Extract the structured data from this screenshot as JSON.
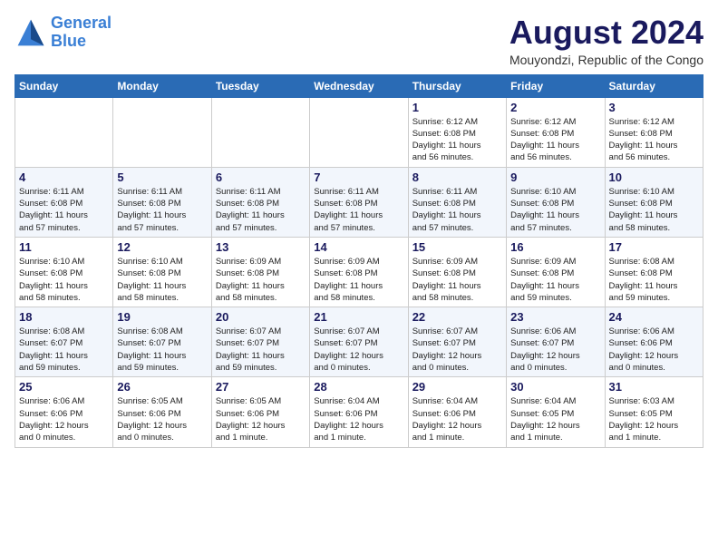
{
  "header": {
    "logo_line1": "General",
    "logo_line2": "Blue",
    "month_year": "August 2024",
    "location": "Mouyondzi, Republic of the Congo"
  },
  "weekdays": [
    "Sunday",
    "Monday",
    "Tuesday",
    "Wednesday",
    "Thursday",
    "Friday",
    "Saturday"
  ],
  "weeks": [
    [
      {
        "day": "",
        "info": ""
      },
      {
        "day": "",
        "info": ""
      },
      {
        "day": "",
        "info": ""
      },
      {
        "day": "",
        "info": ""
      },
      {
        "day": "1",
        "info": "Sunrise: 6:12 AM\nSunset: 6:08 PM\nDaylight: 11 hours\nand 56 minutes."
      },
      {
        "day": "2",
        "info": "Sunrise: 6:12 AM\nSunset: 6:08 PM\nDaylight: 11 hours\nand 56 minutes."
      },
      {
        "day": "3",
        "info": "Sunrise: 6:12 AM\nSunset: 6:08 PM\nDaylight: 11 hours\nand 56 minutes."
      }
    ],
    [
      {
        "day": "4",
        "info": "Sunrise: 6:11 AM\nSunset: 6:08 PM\nDaylight: 11 hours\nand 57 minutes."
      },
      {
        "day": "5",
        "info": "Sunrise: 6:11 AM\nSunset: 6:08 PM\nDaylight: 11 hours\nand 57 minutes."
      },
      {
        "day": "6",
        "info": "Sunrise: 6:11 AM\nSunset: 6:08 PM\nDaylight: 11 hours\nand 57 minutes."
      },
      {
        "day": "7",
        "info": "Sunrise: 6:11 AM\nSunset: 6:08 PM\nDaylight: 11 hours\nand 57 minutes."
      },
      {
        "day": "8",
        "info": "Sunrise: 6:11 AM\nSunset: 6:08 PM\nDaylight: 11 hours\nand 57 minutes."
      },
      {
        "day": "9",
        "info": "Sunrise: 6:10 AM\nSunset: 6:08 PM\nDaylight: 11 hours\nand 57 minutes."
      },
      {
        "day": "10",
        "info": "Sunrise: 6:10 AM\nSunset: 6:08 PM\nDaylight: 11 hours\nand 58 minutes."
      }
    ],
    [
      {
        "day": "11",
        "info": "Sunrise: 6:10 AM\nSunset: 6:08 PM\nDaylight: 11 hours\nand 58 minutes."
      },
      {
        "day": "12",
        "info": "Sunrise: 6:10 AM\nSunset: 6:08 PM\nDaylight: 11 hours\nand 58 minutes."
      },
      {
        "day": "13",
        "info": "Sunrise: 6:09 AM\nSunset: 6:08 PM\nDaylight: 11 hours\nand 58 minutes."
      },
      {
        "day": "14",
        "info": "Sunrise: 6:09 AM\nSunset: 6:08 PM\nDaylight: 11 hours\nand 58 minutes."
      },
      {
        "day": "15",
        "info": "Sunrise: 6:09 AM\nSunset: 6:08 PM\nDaylight: 11 hours\nand 58 minutes."
      },
      {
        "day": "16",
        "info": "Sunrise: 6:09 AM\nSunset: 6:08 PM\nDaylight: 11 hours\nand 59 minutes."
      },
      {
        "day": "17",
        "info": "Sunrise: 6:08 AM\nSunset: 6:08 PM\nDaylight: 11 hours\nand 59 minutes."
      }
    ],
    [
      {
        "day": "18",
        "info": "Sunrise: 6:08 AM\nSunset: 6:07 PM\nDaylight: 11 hours\nand 59 minutes."
      },
      {
        "day": "19",
        "info": "Sunrise: 6:08 AM\nSunset: 6:07 PM\nDaylight: 11 hours\nand 59 minutes."
      },
      {
        "day": "20",
        "info": "Sunrise: 6:07 AM\nSunset: 6:07 PM\nDaylight: 11 hours\nand 59 minutes."
      },
      {
        "day": "21",
        "info": "Sunrise: 6:07 AM\nSunset: 6:07 PM\nDaylight: 12 hours\nand 0 minutes."
      },
      {
        "day": "22",
        "info": "Sunrise: 6:07 AM\nSunset: 6:07 PM\nDaylight: 12 hours\nand 0 minutes."
      },
      {
        "day": "23",
        "info": "Sunrise: 6:06 AM\nSunset: 6:07 PM\nDaylight: 12 hours\nand 0 minutes."
      },
      {
        "day": "24",
        "info": "Sunrise: 6:06 AM\nSunset: 6:06 PM\nDaylight: 12 hours\nand 0 minutes."
      }
    ],
    [
      {
        "day": "25",
        "info": "Sunrise: 6:06 AM\nSunset: 6:06 PM\nDaylight: 12 hours\nand 0 minutes."
      },
      {
        "day": "26",
        "info": "Sunrise: 6:05 AM\nSunset: 6:06 PM\nDaylight: 12 hours\nand 0 minutes."
      },
      {
        "day": "27",
        "info": "Sunrise: 6:05 AM\nSunset: 6:06 PM\nDaylight: 12 hours\nand 1 minute."
      },
      {
        "day": "28",
        "info": "Sunrise: 6:04 AM\nSunset: 6:06 PM\nDaylight: 12 hours\nand 1 minute."
      },
      {
        "day": "29",
        "info": "Sunrise: 6:04 AM\nSunset: 6:06 PM\nDaylight: 12 hours\nand 1 minute."
      },
      {
        "day": "30",
        "info": "Sunrise: 6:04 AM\nSunset: 6:05 PM\nDaylight: 12 hours\nand 1 minute."
      },
      {
        "day": "31",
        "info": "Sunrise: 6:03 AM\nSunset: 6:05 PM\nDaylight: 12 hours\nand 1 minute."
      }
    ]
  ]
}
